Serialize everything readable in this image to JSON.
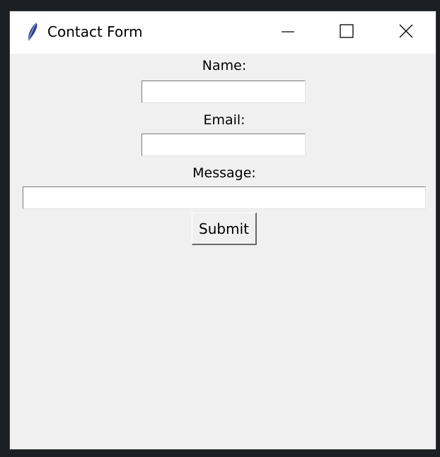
{
  "window": {
    "title": "Contact Form",
    "app_icon": "feather-icon",
    "controls": {
      "minimize": "minimize-icon",
      "maximize": "maximize-icon",
      "close": "close-icon"
    }
  },
  "form": {
    "name_label": "Name:",
    "name_value": "",
    "email_label": "Email:",
    "email_value": "",
    "message_label": "Message:",
    "message_value": "",
    "submit_label": "Submit"
  }
}
